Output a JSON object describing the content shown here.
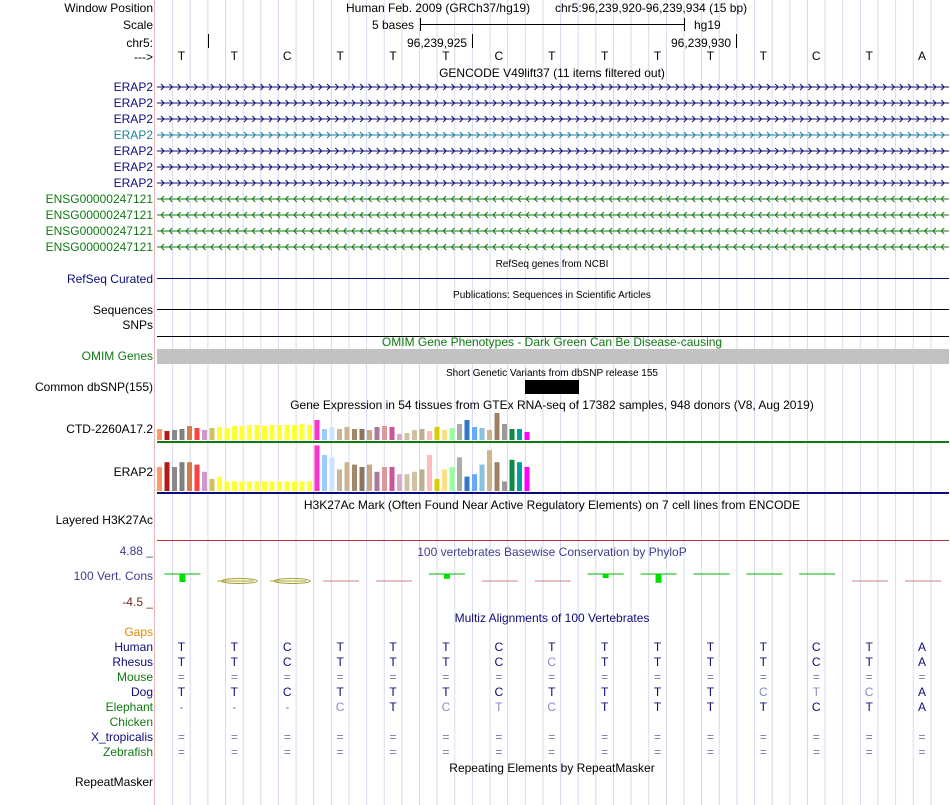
{
  "header": {
    "window_position_label": "Window Position",
    "assembly_text": "Human Feb. 2009 (GRCh37/hg19)",
    "position_text": "chr5:96,239,920-96,239,934 (15 bp)",
    "scale_label": "Scale",
    "scale_text": "5 bases",
    "db_text": "hg19",
    "chrom_label": "chr5:",
    "coord_1": "96,239,925",
    "coord_2": "96,239,930",
    "strand_label": "--->"
  },
  "bases": [
    "T",
    "T",
    "C",
    "T",
    "T",
    "T",
    "C",
    "T",
    "T",
    "T",
    "T",
    "T",
    "C",
    "T",
    "A"
  ],
  "gencode": {
    "title": "GENCODE V49lift37 (11 items filtered out)",
    "items": [
      {
        "name": "ERAP2",
        "color": "#0c0c78",
        "dir": "right"
      },
      {
        "name": "ERAP2",
        "color": "#0c0c78",
        "dir": "right"
      },
      {
        "name": "ERAP2",
        "color": "#0c0c78",
        "dir": "right"
      },
      {
        "name": "ERAP2",
        "color": "#1b7f9b",
        "dir": "right"
      },
      {
        "name": "ERAP2",
        "color": "#0c0c78",
        "dir": "right"
      },
      {
        "name": "ERAP2",
        "color": "#0c0c78",
        "dir": "right"
      },
      {
        "name": "ERAP2",
        "color": "#0c0c78",
        "dir": "right"
      },
      {
        "name": "ENSG00000247121",
        "color": "#107a10",
        "dir": "left"
      },
      {
        "name": "ENSG00000247121",
        "color": "#107a10",
        "dir": "left"
      },
      {
        "name": "ENSG00000247121",
        "color": "#107a10",
        "dir": "left"
      },
      {
        "name": "ENSG00000247121",
        "color": "#107a10",
        "dir": "left"
      }
    ]
  },
  "refseq": {
    "title": "RefSeq genes from NCBI",
    "label": "RefSeq Curated",
    "color": "#0c0c78"
  },
  "publications": {
    "title": "Publications: Sequences in Scientific Articles",
    "label": "Sequences"
  },
  "snps": {
    "label": "SNPs"
  },
  "omim": {
    "title": "OMIM Gene Phenotypes - Dark Green Can Be Disease-causing",
    "label": "OMIM Genes",
    "color": "#107a10"
  },
  "dbsnp": {
    "title": "Short Genetic Variants from dbSNP release 155",
    "label": "Common dbSNP(155)"
  },
  "gtex": {
    "title": "Gene Expression in 54 tissues from GTEx RNA-seq of 17382 samples, 948 donors (V8, Aug 2019)",
    "gene1": "CTD-2260A17.2",
    "gene2": "ERAP2",
    "colors": [
      "#ff9966",
      "#b31a1a",
      "#8a8a8a",
      "#808080",
      "#d97a4d",
      "#ff4040",
      "#cc99cc",
      "#ccc060",
      "#ffff33",
      "#ffff33",
      "#ffff33",
      "#ffff33",
      "#ffff33",
      "#ffff33",
      "#ffff33",
      "#ffff33",
      "#ffff33",
      "#ffff33",
      "#ffff33",
      "#ffff33",
      "#ffff33",
      "#ff33cc",
      "#99ccff",
      "#cce4ff",
      "#c9b59a",
      "#cfb18f",
      "#a0896a",
      "#8f7560",
      "#c8a888",
      "#aa7799",
      "#dd9999",
      "#cc5599",
      "#ddaacc",
      "#d2c0a5",
      "#d2c0a5",
      "#bbb090",
      "#ffbbbb",
      "#ddcc00",
      "#ffdd88",
      "#99ff99",
      "#aaaaaa",
      "#3377cc",
      "#66aaff",
      "#88c0e0",
      "#d2b48c",
      "#a08060",
      "#999999",
      "#118844",
      "#00a0a0",
      "#ff00ff"
    ],
    "values1": [
      0.55,
      0.45,
      0.5,
      0.55,
      0.7,
      0.6,
      0.5,
      0.6,
      0.65,
      0.6,
      0.7,
      0.7,
      0.75,
      0.75,
      0.7,
      0.75,
      0.75,
      0.75,
      0.75,
      0.8,
      0.75,
      1.0,
      0.55,
      0.65,
      0.55,
      0.65,
      0.55,
      0.55,
      0.5,
      0.65,
      0.7,
      0.65,
      0.3,
      0.35,
      0.5,
      0.55,
      0.45,
      0.65,
      0.5,
      0.6,
      0.8,
      1.0,
      0.65,
      0.6,
      0.5,
      1.35,
      0.8,
      0.55,
      0.55,
      0.4
    ],
    "values2": [
      0.5,
      0.6,
      0.5,
      0.6,
      0.6,
      0.55,
      0.4,
      0.25,
      0.3,
      0.2,
      0.2,
      0.2,
      0.2,
      0.2,
      0.2,
      0.2,
      0.2,
      0.2,
      0.2,
      0.2,
      0.2,
      0.95,
      0.75,
      0.7,
      0.45,
      0.6,
      0.55,
      0.5,
      0.55,
      0.4,
      0.5,
      0.5,
      0.35,
      0.35,
      0.4,
      0.45,
      0.75,
      0.25,
      0.45,
      0.5,
      0.7,
      0.3,
      0.35,
      0.55,
      0.85,
      0.6,
      0.2,
      0.65,
      0.6,
      0.5
    ]
  },
  "h3k27ac": {
    "title": "H3K27Ac Mark (Often Found Near Active Regulatory Elements) on 7 cell lines from ENCODE",
    "label": "Layered H3K27Ac"
  },
  "conservation": {
    "title": "100 vertebrates Basewise Conservation by PhyloP",
    "label": "100 Vert. Cons",
    "max_label": "4.88 _",
    "min_label": "-4.5 _",
    "values": [
      1.0,
      -0.5,
      -0.5,
      -0.1,
      -0.1,
      0.6,
      0.0,
      -0.1,
      0.5,
      1.1,
      0.2,
      0.15,
      0.1,
      -0.2,
      -0.1
    ]
  },
  "multiz": {
    "title": "Multiz Alignments of 100 Vertebrates",
    "gaps_label": "Gaps",
    "species": [
      {
        "name": "Human",
        "color": "#0c0c78",
        "bases": [
          "T",
          "T",
          "C",
          "T",
          "T",
          "T",
          "C",
          "T",
          "T",
          "T",
          "T",
          "T",
          "C",
          "T",
          "A"
        ]
      },
      {
        "name": "Rhesus",
        "color": "#0c0c78",
        "bases": [
          "T",
          "T",
          "C",
          "T",
          "T",
          "T",
          "C",
          "C",
          "T",
          "T",
          "T",
          "T",
          "C",
          "T",
          "A"
        ]
      },
      {
        "name": "Mouse",
        "color": "#107a10",
        "bases": [
          "=",
          "=",
          "=",
          "=",
          "=",
          "=",
          "=",
          "=",
          "=",
          "=",
          "=",
          "=",
          "=",
          "=",
          "="
        ]
      },
      {
        "name": "Dog",
        "color": "#0c0c78",
        "bases": [
          "T",
          "T",
          "C",
          "T",
          "T",
          "T",
          "C",
          "T",
          "T",
          "T",
          "T",
          "C",
          "T",
          "C",
          "A"
        ]
      },
      {
        "name": "Elephant",
        "color": "#107a10",
        "bases": [
          "-",
          "-",
          "-",
          "C",
          "T",
          "C",
          "T",
          "C",
          "T",
          "T",
          "T",
          "T",
          "C",
          "T",
          "A"
        ]
      },
      {
        "name": "Chicken",
        "color": "#107a10",
        "bases": [
          "",
          "",
          "",
          "",
          "",
          "",
          "",
          "",
          "",
          "",
          "",
          "",
          "",
          "",
          ""
        ]
      },
      {
        "name": "X_tropicalis",
        "color": "#0c0c78",
        "bases": [
          "=",
          "=",
          "=",
          "=",
          "=",
          "=",
          "=",
          "=",
          "=",
          "=",
          "=",
          "=",
          "=",
          "=",
          "="
        ]
      },
      {
        "name": "Zebrafish",
        "color": "#107a10",
        "bases": [
          "=",
          "=",
          "=",
          "=",
          "=",
          "=",
          "=",
          "=",
          "=",
          "=",
          "=",
          "=",
          "=",
          "=",
          "="
        ]
      }
    ]
  },
  "repeatmasker": {
    "title": "Repeating Elements by RepeatMasker",
    "label": "RepeatMasker"
  },
  "colors": {
    "gap_label": "#e68a00",
    "navy": "#0c0c78",
    "green": "#107a10",
    "phylop": "#3d3d8f",
    "phylop_min": "#7a1f1f"
  }
}
